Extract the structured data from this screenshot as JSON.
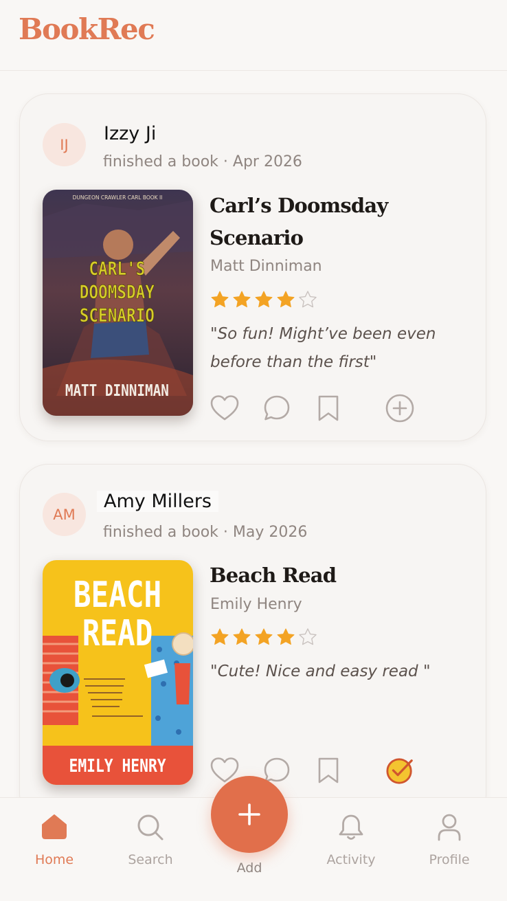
{
  "app": {
    "name": "BookRec"
  },
  "feed": [
    {
      "user": {
        "initials": "IJ",
        "name": "Izzy Ji"
      },
      "activity": "finished a book · Apr 2026",
      "book": {
        "title": "Carl’s Doomsday Scenario",
        "author": "Matt Dinniman",
        "rating": 4,
        "max_rating": 5,
        "review": "\"So fun! Might’ve been even before than the first\"",
        "cover": {
          "series_line": "DUNGEON CRAWLER CARL BOOK II",
          "title_line1": "CARL'S",
          "title_line2": "DOOMSDAY",
          "title_line3": "SCENARIO",
          "author_line": "MATT DINNIMAN"
        }
      },
      "read_marked": false
    },
    {
      "user": {
        "initials": "AM",
        "name": "Amy Millers"
      },
      "activity": "finished a book · May 2026",
      "book": {
        "title": "Beach Read",
        "author": "Emily Henry",
        "rating": 4,
        "max_rating": 5,
        "review": "\"Cute! Nice and easy read \"",
        "cover": {
          "title_line1": "BEACH",
          "title_line2": "READ",
          "author_line": "EMILY HENRY"
        }
      },
      "read_marked": true
    }
  ],
  "nav": {
    "home": "Home",
    "search": "Search",
    "add": "Add",
    "activity": "Activity",
    "profile": "Profile"
  },
  "colors": {
    "accent": "#e16f4b",
    "star": "#f3a324",
    "background": "#f9f7f5"
  }
}
